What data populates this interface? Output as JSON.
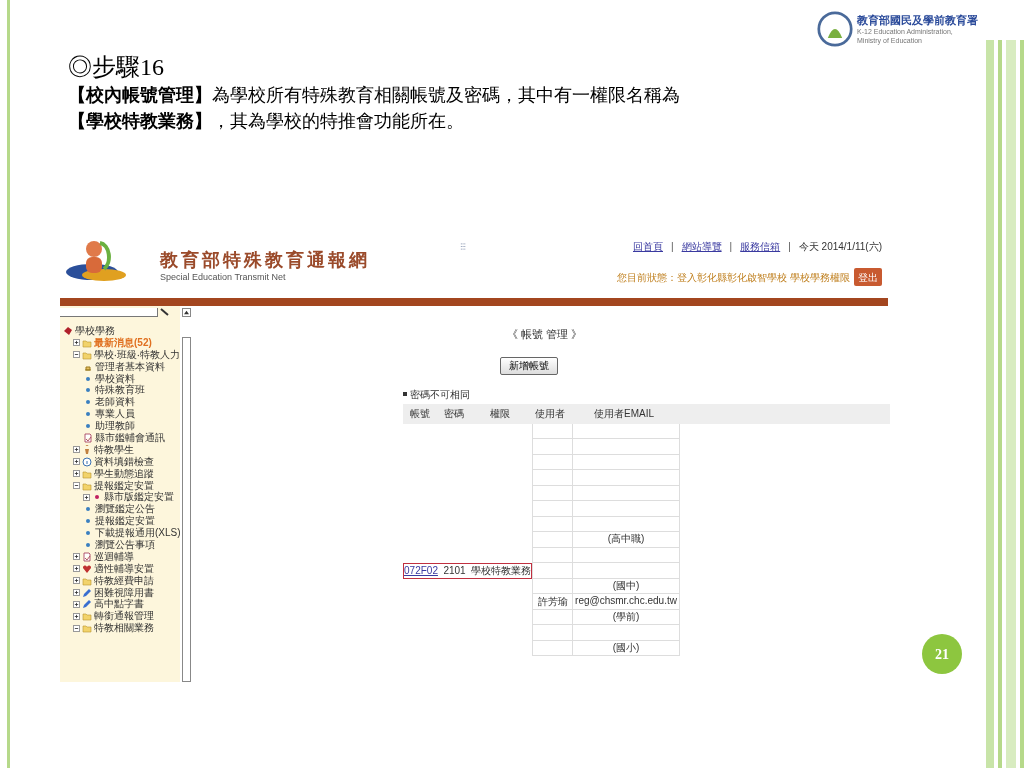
{
  "agency_logo": {
    "name": "教育部國民及學前教育署",
    "subtitle_1": "K-12 Education Administration,",
    "subtitle_2": "Ministry of Education"
  },
  "slide": {
    "title": "◎步驟16",
    "lines": [
      "**【校內帳號管理】**為學校所有特殊教育相關帳號及密碼，其中有一權限名稱為",
      "**【學校特教業務】**，其為學校的特推會功能所在。"
    ],
    "page_number": "21"
  },
  "site": {
    "title": "教育部特殊教育通報網",
    "subtitle": "Special Education Transmit Net",
    "links": [
      "回首頁",
      "網站導覽",
      "服務信箱"
    ],
    "separator": "|",
    "date": "今天 2014/1/11(六)",
    "status": "您目前狀態：登入彰化縣彰化啟智學校 學校學務權限",
    "logout": "登出",
    "tree": [
      {
        "label": "學校學務",
        "kind": "root",
        "children": [
          {
            "label": "最新消息(52)",
            "kind": "folder",
            "expanded": false,
            "highlighted": true
          },
          {
            "label": "學校‧班級‧特教人力",
            "kind": "folder",
            "expanded": true,
            "highlighted": false,
            "children": [
              {
                "label": "管理者基本資料",
                "kind": "person"
              },
              {
                "label": "學校資料",
                "kind": "dot"
              },
              {
                "label": "特殊教育班",
                "kind": "dot"
              },
              {
                "label": "老師資料",
                "kind": "dot"
              },
              {
                "label": "專業人員",
                "kind": "dot"
              },
              {
                "label": "助理教師",
                "kind": "dot"
              },
              {
                "label": "縣市鑑輔會通訊",
                "kind": "doc"
              }
            ]
          },
          {
            "label": "特教學生",
            "kind": "student",
            "expanded": false,
            "highlighted": false
          },
          {
            "label": "資料填錯檢查",
            "kind": "info",
            "expanded": false,
            "highlighted": false
          },
          {
            "label": "學生動態追蹤",
            "kind": "folder",
            "expanded": false,
            "highlighted": false
          },
          {
            "label": "提報鑑定安置",
            "kind": "folder",
            "expanded": true,
            "highlighted": false,
            "children": [
              {
                "label": "縣市版鑑定安置",
                "kind": "star",
                "expanded": false
              },
              {
                "label": "瀏覽鑑定公告",
                "kind": "dot"
              },
              {
                "label": "提報鑑定安置",
                "kind": "dot"
              },
              {
                "label": "下載提報通用(XLS)",
                "kind": "dot"
              },
              {
                "label": "瀏覽公告事項",
                "kind": "dot"
              }
            ]
          },
          {
            "label": "巡迴輔導",
            "kind": "doc",
            "expanded": false,
            "highlighted": false
          },
          {
            "label": "適性輔導安置",
            "kind": "heart",
            "expanded": false,
            "highlighted": false
          },
          {
            "label": "特教經費申請",
            "kind": "folder",
            "expanded": false,
            "highlighted": false
          },
          {
            "label": "困難視障用書",
            "kind": "pencil",
            "expanded": false,
            "highlighted": false
          },
          {
            "label": "高中點字書",
            "kind": "pencil",
            "expanded": false,
            "highlighted": false
          },
          {
            "label": "轉銜通報管理",
            "kind": "folder",
            "expanded": false,
            "highlighted": false
          },
          {
            "label": "特教相關業務",
            "kind": "folder",
            "expanded": true,
            "highlighted": false
          }
        ]
      }
    ],
    "page_title": "《 帳號 管理 》",
    "add_button": "新增帳號",
    "note": "密碼不可相同",
    "table": {
      "columns": [
        "帳號",
        "密碼",
        "權限",
        "使用者",
        "使用者EMAIL"
      ],
      "rows": [
        {
          "highlighted": false
        },
        {
          "highlighted": false
        },
        {
          "highlighted": false
        },
        {
          "highlighted": false
        },
        {
          "highlighted": false
        },
        {
          "highlighted": false
        },
        {
          "highlighted": false
        },
        {
          "email": "(高中職)",
          "highlighted": false
        },
        {
          "highlighted": false
        },
        {
          "account": "072F02",
          "password": "2101",
          "role": "學校特教業務",
          "highlighted": true
        },
        {
          "email": "(國中)",
          "highlighted": false
        },
        {
          "user": "許芳瑜",
          "email": "reg@chsmr.chc.edu.tw",
          "highlighted": false
        },
        {
          "email": "(學前)",
          "highlighted": false
        },
        {
          "highlighted": false
        },
        {
          "email": "(國小)",
          "highlighted": false
        }
      ]
    }
  }
}
